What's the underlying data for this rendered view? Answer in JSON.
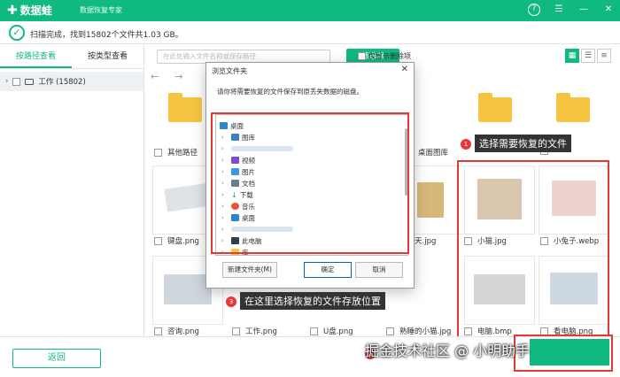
{
  "app": {
    "logo": "数据蛙",
    "subtitle": "数据恢复专家",
    "help_icon": "?",
    "colors": {
      "accent": "#10b981",
      "annotation": "#e53935"
    }
  },
  "scan": {
    "status": "扫描完成，找到15802个文件共1.03 GB。"
  },
  "sidebar": {
    "tabs": [
      "按路径查看",
      "按类型查看"
    ],
    "tree_item": "工作 (15802)"
  },
  "toolbar": {
    "search_placeholder": "在此处输入文件名称或保存路径",
    "filter": "筛选器",
    "only_deleted": "仅显示删除项"
  },
  "files": [
    {
      "name": "其他路径"
    },
    {
      "name": "桌面图库"
    },
    {
      "name": "键盘.png"
    },
    {
      "name": "天.jpg"
    },
    {
      "name": "小猫.jpg"
    },
    {
      "name": "小兔子.webp"
    },
    {
      "name": "咨询.png"
    },
    {
      "name": "工作.png"
    },
    {
      "name": "U盘.png"
    },
    {
      "name": "熟睡的小猫.jpg"
    },
    {
      "name": "电脑.bmp"
    },
    {
      "name": "看电脑.png"
    }
  ],
  "annotations": {
    "a1": "选择需要恢复的文件",
    "a3": "在这里选择恢复的文件存放位置",
    "n1": "1",
    "n2": "2",
    "n3": "3"
  },
  "dialog": {
    "title": "浏览文件夹",
    "close": "✕",
    "description": "请你将需要恢复的文件保存到原丢失数据的磁盘。",
    "tree": [
      "桌面",
      "图库",
      "视频",
      "图片",
      "文档",
      "下载",
      "音乐",
      "桌面",
      "此电脑",
      "库"
    ],
    "buttons": {
      "new_folder": "新建文件夹(M)",
      "ok": "确定",
      "cancel": "取消"
    }
  },
  "bottom": {
    "back": "返回"
  },
  "watermark": "掘金技术社区 @ 小明助手"
}
